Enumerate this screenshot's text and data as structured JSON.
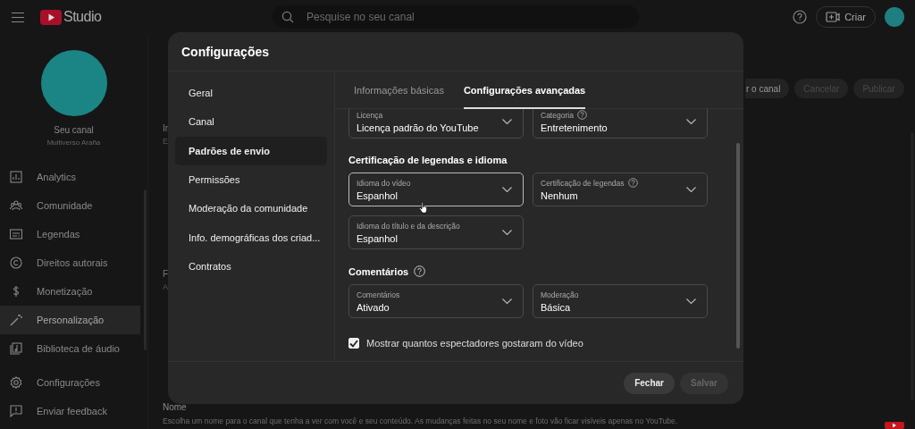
{
  "topbar": {
    "brand": "Studio",
    "search": {
      "placeholder": "Pesquise no seu canal"
    },
    "create_button": "Criar"
  },
  "sidebar": {
    "channel_title": "Seu canal",
    "channel_name": "Multiverso Araña",
    "items": [
      {
        "label": "Analytics",
        "selected": false
      },
      {
        "label": "Comunidade",
        "selected": false
      },
      {
        "label": "Legendas",
        "selected": false
      },
      {
        "label": "Direitos autorais",
        "selected": false
      },
      {
        "label": "Monetização",
        "selected": false
      },
      {
        "label": "Personalização",
        "selected": true
      },
      {
        "label": "Biblioteca de áudio",
        "selected": false
      }
    ],
    "footer_items": [
      {
        "label": "Configurações"
      },
      {
        "label": "Enviar feedback"
      }
    ]
  },
  "main": {
    "fragments": [
      {
        "title": "Ir",
        "text": "E"
      },
      {
        "title": "F",
        "text": "A"
      }
    ],
    "actions": [
      {
        "label": "r o canal",
        "disabled": false
      },
      {
        "label": "Cancelar",
        "disabled": true
      },
      {
        "label": "Publicar",
        "disabled": true
      }
    ],
    "name_section": {
      "title": "Nome",
      "description": "Escolha um nome para o canal que tenha a ver com você e seu conteúdo. As mudanças feitas no seu nome e foto vão ficar visíveis apenas no YouTube."
    }
  },
  "dialog": {
    "title": "Configurações",
    "nav": [
      {
        "label": "Geral",
        "selected": false
      },
      {
        "label": "Canal",
        "selected": false
      },
      {
        "label": "Padrões de envio",
        "selected": true
      },
      {
        "label": "Permissões",
        "selected": false
      },
      {
        "label": "Moderação da comunidade",
        "selected": false
      },
      {
        "label": "Info. demográficas dos criad...",
        "selected": false
      },
      {
        "label": "Contratos",
        "selected": false
      }
    ],
    "tabs": [
      {
        "label": "Informações básicas",
        "selected": false
      },
      {
        "label": "Configurações avançadas",
        "selected": true
      }
    ],
    "sections": [
      {
        "fields": [
          {
            "label": "Licença",
            "value": "Licença padrão do YouTube",
            "help": false,
            "focused": false
          },
          {
            "label": "Categoria",
            "value": "Entretenimento",
            "help": true,
            "focused": false
          }
        ]
      },
      {
        "heading": "Certificação de legendas e idioma",
        "help": false,
        "fields": [
          {
            "label": "Idioma do vídeo",
            "value": "Espanhol",
            "help": false,
            "focused": true
          },
          {
            "label": "Certificação de legendas",
            "value": "Nenhum",
            "help": true,
            "focused": false
          },
          {
            "label": "Idioma do título e da descrição",
            "value": "Espanhol",
            "help": false,
            "focused": false
          }
        ]
      },
      {
        "heading": "Comentários",
        "help": true,
        "fields": [
          {
            "label": "Comentários",
            "value": "Ativado",
            "help": false,
            "focused": false
          },
          {
            "label": "Moderação",
            "value": "Básica",
            "help": false,
            "focused": false
          }
        ]
      }
    ],
    "checkbox": {
      "label": "Mostrar quantos espectadores gostaram do vídeo",
      "checked": true
    },
    "buttons": [
      {
        "label": "Fechar",
        "disabled": false
      },
      {
        "label": "Salvar",
        "disabled": true
      }
    ]
  }
}
